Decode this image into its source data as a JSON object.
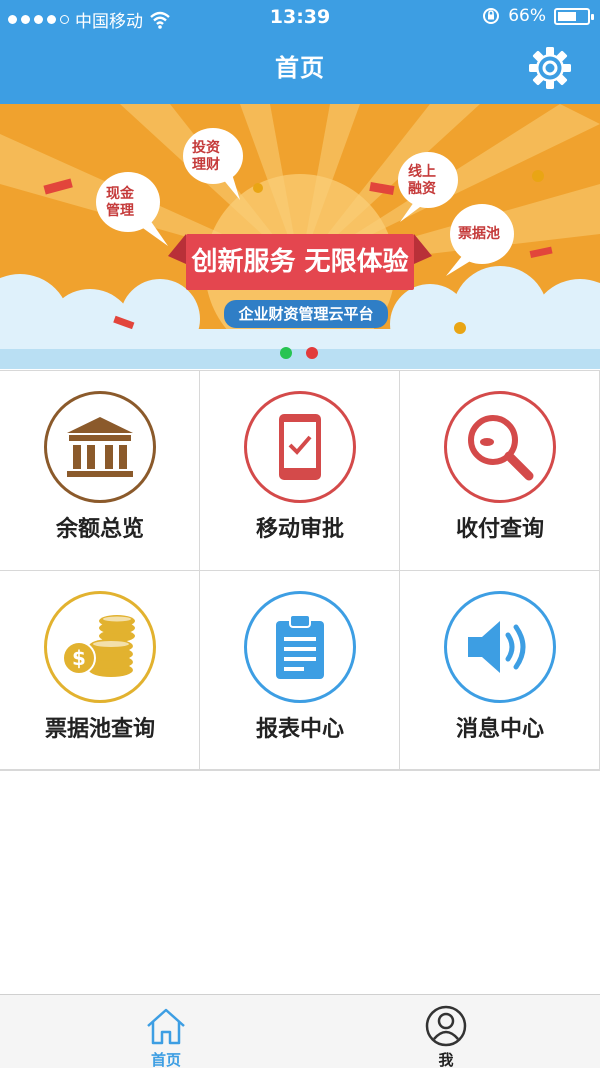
{
  "status_bar": {
    "carrier": "中国移动",
    "time": "13:39",
    "battery": "66%",
    "battery_level": 0.66
  },
  "nav": {
    "title": "首页",
    "settings_icon": "gear-icon"
  },
  "banner": {
    "headline": "创新服务 无限体验",
    "subline": "企业财资管理云平台",
    "bubbles": [
      "现金\n管理",
      "投资\n理财",
      "线上\n融资",
      "票据池"
    ],
    "active_page": 1,
    "colors": {
      "background": "#f0a22e",
      "headline_bg": "#e4464f",
      "subline_bg": "#2f7ec6",
      "dot_active": "#e23b3b",
      "dot_inactive": "#27c451"
    }
  },
  "menu": [
    {
      "label": "余额总览",
      "icon": "bank-icon",
      "color": "#8b5a2b"
    },
    {
      "label": "移动审批",
      "icon": "mobile-approval-icon",
      "color": "#d44a4a"
    },
    {
      "label": "收付查询",
      "icon": "magnifier-icon",
      "color": "#d44a4a"
    },
    {
      "label": "票据池查询",
      "icon": "coins-icon",
      "color": "#e2b22f"
    },
    {
      "label": "报表中心",
      "icon": "clipboard-icon",
      "color": "#3d9ee3"
    },
    {
      "label": "消息中心",
      "icon": "speaker-icon",
      "color": "#3d9ee3"
    }
  ],
  "tabbar": {
    "tabs": [
      {
        "label": "首页",
        "icon": "home-icon",
        "active": true
      },
      {
        "label": "我",
        "icon": "user-icon",
        "active": false
      }
    ],
    "active_color": "#3d9ee3"
  }
}
